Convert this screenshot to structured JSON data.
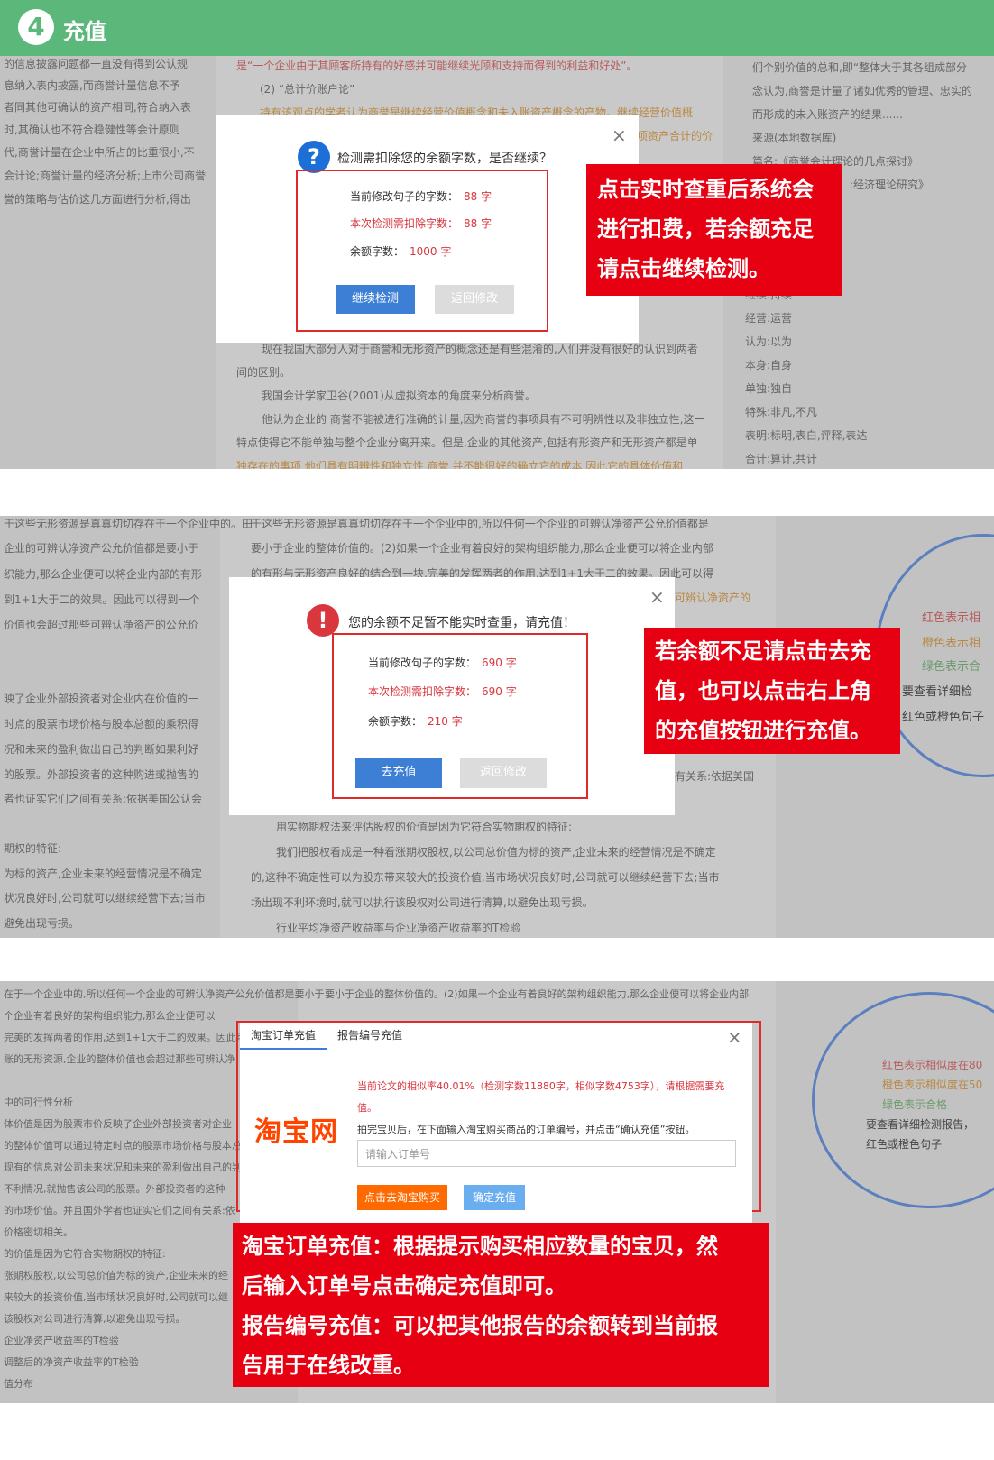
{
  "header": {
    "step_number": "4",
    "title": "充值"
  },
  "panel1": {
    "bg_left": [
      "的信息披露问题都一直没有得到公认规",
      "息纳入表内披露,而商誉计量信息不予",
      "者同其他可确认的资产相同,符合纳入表",
      "时,其确认也不符合稳健性等会计原则",
      "代,商誉计量在企业中所占的比重很小,不",
      "会计论;商誉计量的经济分析;上市公司商誉",
      "誉的策略与估价这几方面进行分析,得出"
    ],
    "bg_main_top": [
      "是“一个企业由于其顾客所持有的好感并可能继续光顾和支持而得到的利益和好处”。",
      "(2) “总计价账户论”",
      "持有该观点的学者认为商誉是继续经营价值概念和未入账资产概念的产物。继续经营价值概",
      "项资产合计的价"
    ],
    "bg_main_bottom": [
      "现在我国大部分人对于商誉和无形资产的概念还是有些混淆的,人们并没有很好的认识到两者",
      "间的区别。",
      "我国会计学家卫谷(2001)从虚拟资本的角度来分析商誉。",
      "他认为企业的 商誉不能被进行准确的计量,因为商誉的事项具有不可明辨性以及非独立性,这一",
      "特点使得它不能单独与整个企业分离开来。但是,企业的其他资产,包括有形资产和无形资产都是单",
      "独存在的事项 他们具有明辨性和独立性 商誉 并不能很好的确立它的成本 因此它的具体价值和"
    ],
    "bg_right_top": [
      "们个别价值的总和,即“整体大于其各组成部分",
      "念认为,商誉是计量了诸如优秀的管理、忠实的",
      "而形成的未入账资产的结果......",
      "来源(本地数据库)",
      "篇名:《商誉会计理论的几点探讨》",
      ":经济理论研究》"
    ],
    "bg_right_bottom": [
      "继续:持续",
      "经营:运营",
      "认为:以为",
      "本身:自身",
      "单独:独自",
      "特殊:非凡,不凡",
      "表明:标明,表白,评释,表达",
      "合计:算计,共计"
    ],
    "modal": {
      "question": "检测需扣除您的余额字数，是否继续？",
      "line1_label": "当前修改句子的字数：",
      "line1_value": "88 字",
      "line2_label": "本次检测需扣除字数：",
      "line2_value": "88 字",
      "line3_label": "余额字数：",
      "line3_value": "1000 字",
      "btn_continue": "继续检测",
      "btn_return": "返回修改"
    },
    "callout": [
      "点击实时查重后系统会",
      "进行扣费，若余额充足",
      "请点击继续检测。"
    ]
  },
  "panel2": {
    "bg_left": [
      "于这些无形资源是真真切切存在于一个企业中的。田",
      "企业的可辨认净资产公允价值都是要小于",
      "织能力,那么企业便可以将企业内部的有形",
      "到1+1大于二的效果。因此可以得到一个",
      "价值也会超过那些可辨认净资产的公允价",
      "映了企业外部投资者对企业内在价值的一",
      "时点的股票市场价格与股本总额的乘积得",
      "况和未来的盈利做出自己的判断如果利好",
      "的股票。外部投资者的这种购进或抛售的",
      "者也证实它们之间有关系:依据美国公认会",
      "期权的特征:",
      "为标的资产,企业未来的经营情况是不确定",
      "状况良好时,公司就可以继续经营下去;当市",
      "避免出现亏损。"
    ],
    "bg_main_top": [
      "于这些无形资源是真真切切存在于一个企业中的,所以任何一个企业的可辨认净资产公允价值都是",
      "要小于企业的整体价值的。(2)如果一个企业有着良好的架构组织能力,那么企业便可以将企业内部",
      "的有形与无形资产良好的结合到一块,完美的发挥两者的作用,达到1+1大于二的效果。因此可以得",
      "可辨认净资产的"
    ],
    "bg_main_bottom": [
      "用实物期权法来评估股权的价值是因为它符合实物期权的特征:",
      "我们把股权看成是一种看涨期权股权,以公司总价值为标的资产,企业未来的经营情况是不确定",
      "的,这种不确定性可以为股东带来较大的投资价值,当市场状况良好时,公司就可以继续经营下去;当市",
      "场出现不利环境时,就可以执行该股权对公司进行清算,以避免出现亏损。",
      "行业平均净资产收益率与企业净资产收益率的T检验"
    ],
    "bg_under_modal": "有关系:依据美国",
    "legend": [
      "红色表示相",
      "橙色表示相",
      "绿色表示合",
      "要查看详细检",
      "红色或橙色句子"
    ],
    "modal": {
      "title": "您的余额不足暂不能实时查重，请充值！",
      "line1_label": "当前修改句子的字数：",
      "line1_value": "690 字",
      "line2_label": "本次检测需扣除字数：",
      "line2_value": "690 字",
      "line3_label": "余额字数：",
      "line3_value": "210 字",
      "btn_recharge": "去充值",
      "btn_return": "返回修改"
    },
    "callout": [
      "若余额不足请点击去充",
      "值，也可以点击右上角",
      "的充值按钮进行充值。"
    ]
  },
  "panel3": {
    "bg_left": [
      "在于一个企业中的,所以任何一个企业的可辨认净资产公允价值都是要小于",
      "个企业有着良好的架构组织能力,那么企业便可以",
      "完美的发挥两者的作用,达到1+1大于二的效果。因此可",
      "账的无形资源,企业的整体价值也会超过那些可辨认净",
      "中的可行性分析",
      "体价值是因为股票市价反映了企业外部投资者对企业",
      "的整体价值可以通过特定时点的股票市场价格与股本总",
      "现有的信息对公司未来状况和未来的盈利做出自己的判",
      "不利情况,就抛售该公司的股票。外部投资者的这种",
      "的市场价值。并且国外学者也证实它们之间有关系:依",
      "价格密切相关。",
      "的价值是因为它符合实物期权的特征:",
      "涨期权股权,以公司总价值为标的资产,企业未来的经",
      "来较大的投资价值,当市场状况良好时,公司就可以继",
      "该股权对公司进行清算,以避免出现亏损。",
      "企业净资产收益率的T检验",
      "调整后的净资产收益率的T检验",
      "值分布"
    ],
    "bg_main_top": [
      "要小于企业的整体价值的。(2)如果一个企业有着良好的架构组织能力,那么企业便可以将企业内部"
    ],
    "legend": [
      "红色表示相似度在80",
      "橙色表示相似度在50",
      "绿色表示合格",
      "要查看详细检测报告，",
      "红色或橙色句子"
    ],
    "modal": {
      "tab_taobao": "淘宝订单充值",
      "tab_report": "报告编号充值",
      "logo": "淘宝网",
      "notice_line1": "当前论文的相似率40.01%（检测字数11880字，相似字数4753字），请根据需要充",
      "notice_line2": "值。",
      "instruction": "拍完宝贝后，在下面输入淘宝购买商品的订单编号，并点击“确认充值”按钮。",
      "input_placeholder": "请输入订单号",
      "btn_buy": "点击去淘宝购买",
      "btn_confirm": "确定充值"
    },
    "callout": [
      "淘宝订单充值：根据提示购买相应数量的宝贝，然",
      "后输入订单号点击确定充值即可。",
      "报告编号充值：可以把其他报告的余额转到当前报",
      "告用于在线改重。"
    ]
  }
}
